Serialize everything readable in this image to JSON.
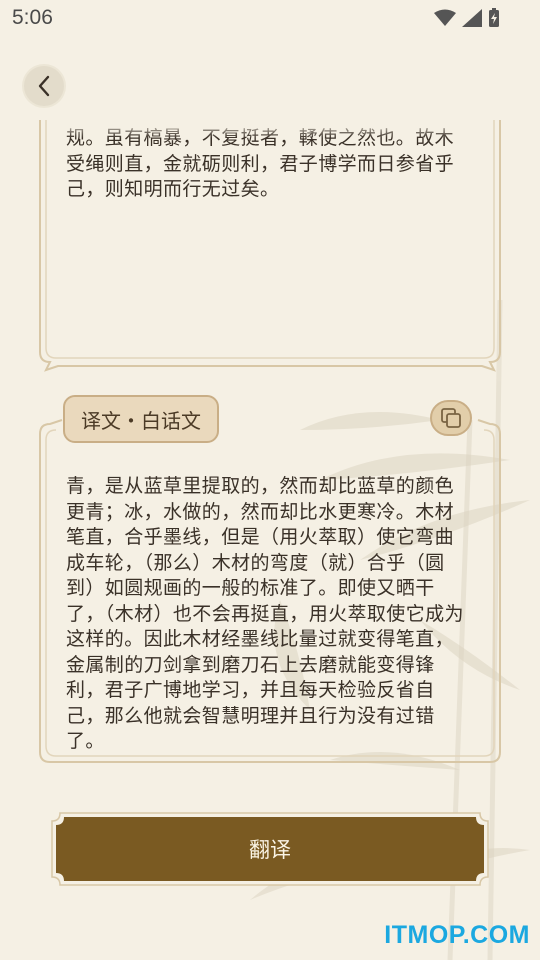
{
  "status_bar": {
    "time": "5:06",
    "icons": [
      "wifi-icon",
      "signal-icon",
      "battery-charging-icon"
    ]
  },
  "header": {
    "back_icon": "chevron-left-icon"
  },
  "source_card": {
    "text": "规。虽有槁暴，不复挺者，輮使之然也。故木受绳则直，金就砺则利，君子博学而日参省乎己，则知明而行无过矣。"
  },
  "translation_card": {
    "tag_label": "译文・白话文",
    "copy_icon": "copy-icon",
    "text": "青，是从蓝草里提取的，然而却比蓝草的颜色更青；冰，水做的，然而却比水更寒冷。木材笔直，合乎墨线，但是（用火萃取）使它弯曲成车轮，（那么）木材的弯度（就）合乎（圆到）如圆规画的一般的标准了。即使又晒干了，（木材）也不会再挺直，用火萃取使它成为这样的。因此木材经墨线比量过就变得笔直，金属制的刀剑拿到磨刀石上去磨就能变得锋利，君子广博地学习，并且每天检验反省自己，那么他就会智慧明理并且行为没有过错了。"
  },
  "action": {
    "translate_label": "翻译"
  },
  "watermark": "ITMOP.COM",
  "colors": {
    "background": "#f5f0e4",
    "button": "#7a5a22",
    "border": "#d8c7a6",
    "tag": "#ead9bd",
    "watermark": "#1ba8e0"
  }
}
